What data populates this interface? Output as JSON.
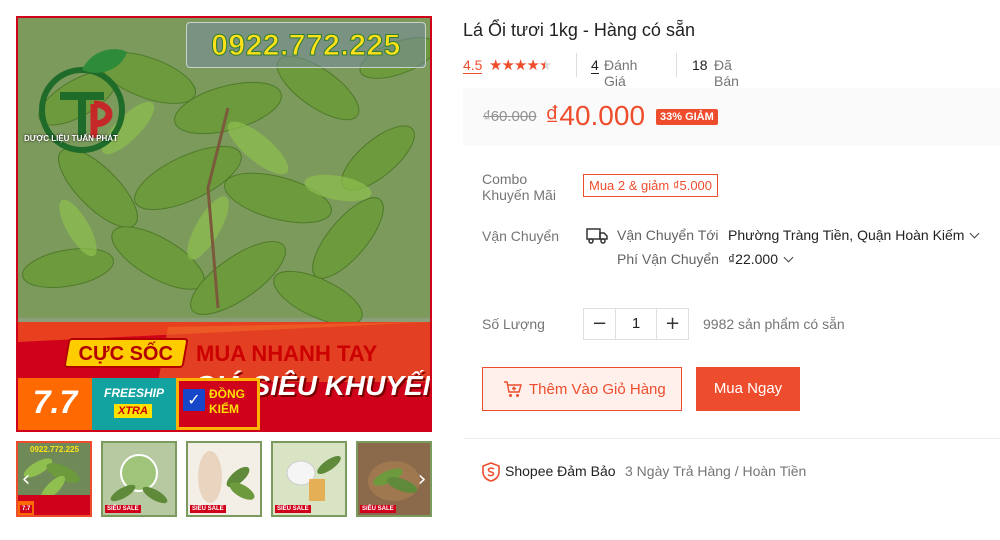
{
  "gallery": {
    "phone": "0922.772.225",
    "brand_name": "DƯỢC LIỆU TUẤN PHÁT",
    "banner_hot": "CỰC SỐC",
    "banner_line1": "MUA NHANH TAY",
    "banner_line2": "GIÁ SIÊU KHUYẾN MẠI",
    "badge_77": "7.7",
    "freeship": "FREESHIP",
    "xtra": "XTRA",
    "dong_kiem": "ĐỒNG KIỂM",
    "thumbnails": [
      {
        "label": "7.7",
        "phone": "0922.772.225"
      },
      {
        "label": "SIÊU SALE"
      },
      {
        "label": "SIÊU SALE"
      },
      {
        "label": "SIÊU SALE"
      },
      {
        "label": "SIÊU SALE"
      }
    ],
    "prev_arrow": "‹",
    "next_arrow": "›"
  },
  "product": {
    "title": "Lá Ổi tươi 1kg - Hàng có sẵn",
    "rating": "4.5",
    "stars": 4.5,
    "review_count": "4",
    "review_label": "Đánh Giá",
    "sold_count": "18",
    "sold_label": "Đã Bán"
  },
  "price": {
    "old": "₫60.000",
    "new": "₫40.000",
    "discount": "33% GIẢM"
  },
  "combo": {
    "label": "Combo Khuyến Mãi",
    "tag": "Mua 2 & giảm ₫5.000"
  },
  "shipping": {
    "label": "Vận Chuyển",
    "to_label": "Vận Chuyển Tới",
    "to_value": "Phường Tràng Tiền, Quận Hoàn Kiếm",
    "fee_label": "Phí Vận Chuyển",
    "fee_value": "₫22.000"
  },
  "quantity": {
    "label": "Số Lượng",
    "minus": "−",
    "value": "1",
    "plus": "+",
    "stock": "9982 sản phẩm có sẵn"
  },
  "actions": {
    "add_to_cart": "Thêm Vào Giỏ Hàng",
    "buy_now": "Mua Ngay"
  },
  "guarantee": {
    "title": "Shopee Đảm Bảo",
    "desc": "3 Ngày Trả Hàng / Hoàn Tiền"
  },
  "colors": {
    "accent": "#ee4d2d",
    "banner_red": "#d0011b",
    "leaf_green": "#5e8a3a"
  }
}
